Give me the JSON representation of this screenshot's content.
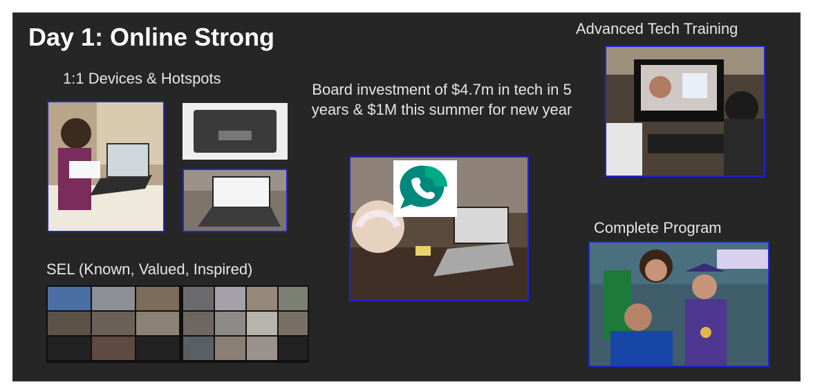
{
  "slide": {
    "title": "Day 1: Online Strong",
    "devices_label": "1:1 Devices & Hotspots",
    "investment_label": "Board investment of $4.7m in tech in 5 years & $1M this summer for new year",
    "tech_training_label": "Advanced Tech Training",
    "complete_program_label": "Complete Program",
    "sel_label": "SEL (Known, Valued, Inspired)"
  },
  "colors": {
    "slide_bg": "#262626",
    "photo_border": "#1f24d9",
    "meet_green": "#00897b",
    "meet_light": "#4ade80"
  },
  "icons": {
    "meet_logo": "google-meet-logo-icon"
  }
}
